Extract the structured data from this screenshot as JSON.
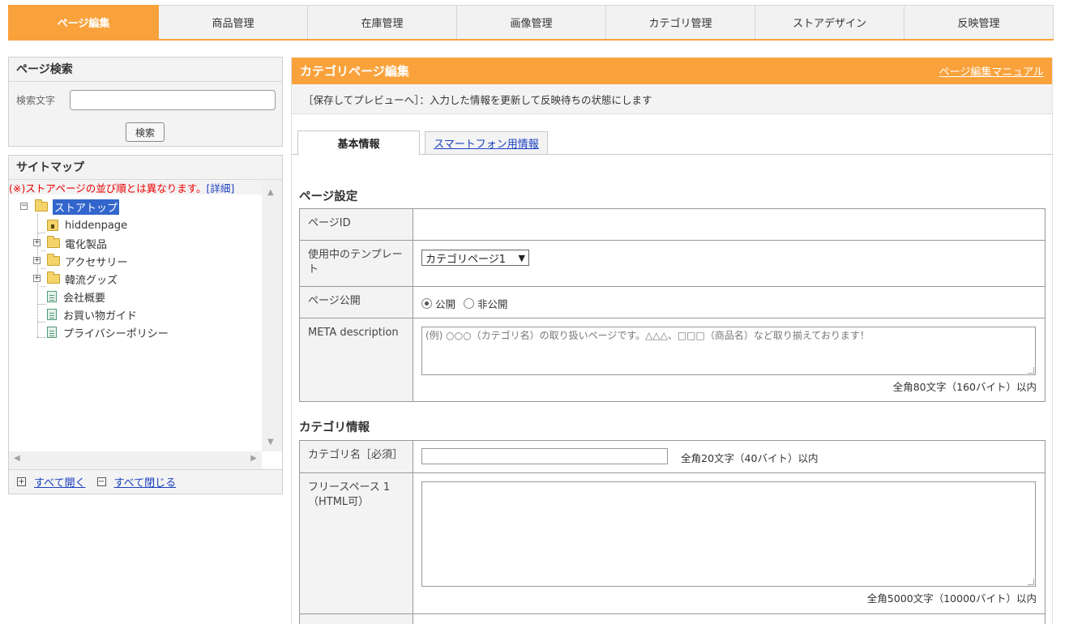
{
  "topnav": {
    "tabs": [
      {
        "label": "ページ編集",
        "active": true
      },
      {
        "label": "商品管理"
      },
      {
        "label": "在庫管理"
      },
      {
        "label": "画像管理"
      },
      {
        "label": "カテゴリ管理"
      },
      {
        "label": "ストアデザイン"
      },
      {
        "label": "反映管理"
      }
    ]
  },
  "search": {
    "title": "ページ検索",
    "field_label": "検索文字",
    "value": "",
    "button": "検索"
  },
  "sitemap": {
    "title": "サイトマップ",
    "note": "(※)ストアページの並び順とは異なります。",
    "note_detail": "[詳細]",
    "nodes": [
      {
        "label": "ストアトップ",
        "icon": "folder-icon",
        "selected": true
      },
      {
        "label": "hiddenpage",
        "icon": "lock-icon"
      },
      {
        "label": "電化製品",
        "icon": "folder-icon",
        "expander": "+"
      },
      {
        "label": "アクセサリー",
        "icon": "folder-icon",
        "expander": "+"
      },
      {
        "label": "韓流グッズ",
        "icon": "folder-icon",
        "expander": "+"
      },
      {
        "label": "会社概要",
        "icon": "page-icon"
      },
      {
        "label": "お買い物ガイド",
        "icon": "page-icon"
      },
      {
        "label": "プライバシーポリシー",
        "icon": "page-icon"
      }
    ],
    "expand_all": "すべて開く",
    "collapse_all": "すべて閉じる"
  },
  "main": {
    "title": "カテゴリページ編集",
    "manual_link": "ページ編集マニュアル",
    "notice": "［保存してプレビューへ］：入力した情報を更新して反映待ちの状態にします",
    "tabs": [
      {
        "label": "基本情報",
        "active": true
      },
      {
        "label": "スマートフォン用情報"
      }
    ],
    "page_settings": {
      "title": "ページ設定",
      "page_id_label": "ページID",
      "page_id_value": "",
      "template_label": "使用中のテンプレート",
      "template_value": "カテゴリページ1",
      "publish_label": "ページ公開",
      "publish_options": [
        "公開",
        "非公開"
      ],
      "publish_selected": "公開",
      "meta_label": "META description",
      "meta_placeholder": "(例) ○○○（カテゴリ名）の取り扱いページです。△△△、□□□（商品名）など取り揃えております！",
      "meta_hint": "全角80文字（160バイト）以内"
    },
    "category_info": {
      "title": "カテゴリ情報",
      "name_label": "カテゴリ名［必須］",
      "name_value": "",
      "name_hint": "全角20文字（40バイト）以内",
      "free1_label": "フリースペース 1（HTML可）",
      "free1_value": "",
      "free1_hint": "全角5000文字（10000バイト）以内"
    }
  }
}
